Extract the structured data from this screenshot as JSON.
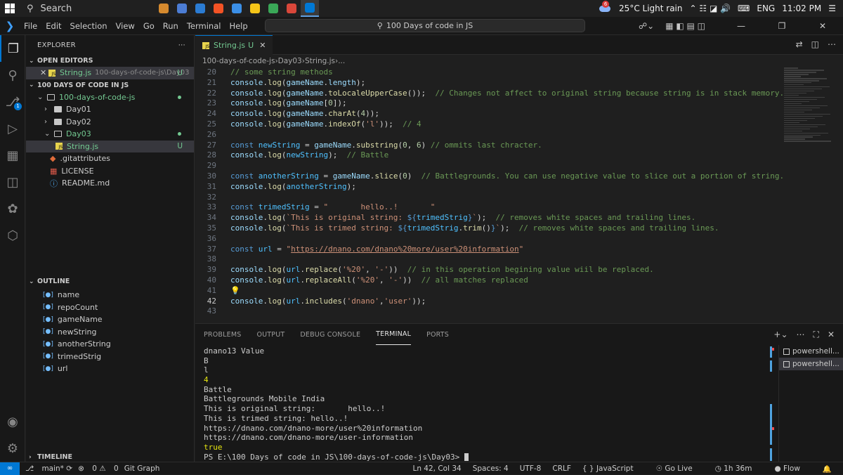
{
  "taskbar": {
    "search_placeholder": "Search",
    "weather_badge": "6",
    "weather": "25°C  Light rain",
    "lang": "ENG",
    "time": "11:02 PM",
    "apps": [
      "#d68a2e",
      "#4c7dd4",
      "#2b7cd3",
      "#f35325",
      "#3b8fe6",
      "#f5c518",
      "#3aa757",
      "#d9473a",
      "#0078d4"
    ]
  },
  "titlebar": {
    "menu": [
      "File",
      "Edit",
      "Selection",
      "View",
      "Go",
      "Run",
      "Terminal",
      "Help"
    ],
    "command_center": "100 Days of code in JS"
  },
  "sidebar": {
    "title": "EXPLORER",
    "open_editors_label": "OPEN EDITORS",
    "open_editor_file": "String.js",
    "open_editor_path": "100-days-of-code-js\\Day03",
    "open_editor_badge": "U",
    "project_label": "100 DAYS OF CODE IN JS",
    "root_folder": "100-days-of-code-js",
    "day01": "Day01",
    "day02": "Day02",
    "day03": "Day03",
    "file_string": "String.js",
    "file_badge": "U",
    "file_gitattributes": ".gitattributes",
    "file_license": "LICENSE",
    "file_readme": "README.md",
    "outline_label": "OUTLINE",
    "outline": [
      "name",
      "repoCount",
      "gameName",
      "newString",
      "anotherString",
      "trimedStrig",
      "url"
    ],
    "timeline_label": "TIMELINE"
  },
  "editor": {
    "tab_label": "String.js",
    "tab_badge": "U",
    "breadcrumb": [
      "100-days-of-code-js",
      "Day03",
      "String.js",
      "..."
    ],
    "lines": [
      {
        "n": "20",
        "html": "<span class=\"c\">// some string methods</span>"
      },
      {
        "n": "21",
        "html": "<span class=\"v\">console</span>.<span class=\"f\">log</span>(<span class=\"v\">gameName</span>.<span class=\"v\">length</span>);"
      },
      {
        "n": "22",
        "html": "<span class=\"v\">console</span>.<span class=\"f\">log</span>(<span class=\"v\">gameName</span>.<span class=\"f\">toLocaleUpperCase</span>());  <span class=\"c\">// Changes not affect to original string because string is in stack memory.</span>"
      },
      {
        "n": "23",
        "html": "<span class=\"v\">console</span>.<span class=\"f\">log</span>(<span class=\"v\">gameName</span>[<span class=\"n\">0</span>]);"
      },
      {
        "n": "24",
        "html": "<span class=\"v\">console</span>.<span class=\"f\">log</span>(<span class=\"v\">gameName</span>.<span class=\"f\">charAt</span>(<span class=\"n\">4</span>));"
      },
      {
        "n": "25",
        "html": "<span class=\"v\">console</span>.<span class=\"f\">log</span>(<span class=\"v\">gameName</span>.<span class=\"f\">indexOf</span>(<span class=\"s\">'l'</span>));  <span class=\"c\">// 4</span>"
      },
      {
        "n": "26",
        "html": ""
      },
      {
        "n": "27",
        "html": "<span class=\"k\">const</span> <span class=\"cst\">newString</span> = <span class=\"v\">gameName</span>.<span class=\"f\">substring</span>(<span class=\"n\">0</span>, <span class=\"n\">6</span>) <span class=\"c\">// ommits last chracter.</span>"
      },
      {
        "n": "28",
        "html": "<span class=\"v\">console</span>.<span class=\"f\">log</span>(<span class=\"cst\">newString</span>);  <span class=\"c\">// Battle</span>"
      },
      {
        "n": "29",
        "html": ""
      },
      {
        "n": "30",
        "html": "<span class=\"k\">const</span> <span class=\"cst\">anotherString</span> = <span class=\"v\">gameName</span>.<span class=\"f\">slice</span>(<span class=\"n\">0</span>)  <span class=\"c\">// Battlegrounds. You can use negative value to slice out a portion of string.</span>"
      },
      {
        "n": "31",
        "html": "<span class=\"v\">console</span>.<span class=\"f\">log</span>(<span class=\"cst\">anotherString</span>);"
      },
      {
        "n": "32",
        "html": ""
      },
      {
        "n": "33",
        "html": "<span class=\"k\">const</span> <span class=\"cst\">trimedStrig</span> = <span class=\"s\">\"       hello..!       \"</span>"
      },
      {
        "n": "34",
        "html": "<span class=\"v\">console</span>.<span class=\"f\">log</span>(<span class=\"s\">`This is original string: </span><span class=\"k\">${</span><span class=\"cst\">trimedStrig</span><span class=\"k\">}</span><span class=\"s\">`</span>);  <span class=\"c\">// removes white spaces and trailing lines.</span>"
      },
      {
        "n": "35",
        "html": "<span class=\"v\">console</span>.<span class=\"f\">log</span>(<span class=\"s\">`This is trimed string: </span><span class=\"k\">${</span><span class=\"cst\">trimedStrig</span>.<span class=\"f\">trim</span>()<span class=\"k\">}</span><span class=\"s\">`</span>);  <span class=\"c\">// removes white spaces and trailing lines.</span>"
      },
      {
        "n": "36",
        "html": ""
      },
      {
        "n": "37",
        "html": "<span class=\"k\">const</span> <span class=\"cst\">url</span> = <span class=\"s\">\"<span class=\"ul\">https://dnano.com/dnano%20more/user%20information</span>\"</span>"
      },
      {
        "n": "38",
        "html": ""
      },
      {
        "n": "39",
        "html": "<span class=\"v\">console</span>.<span class=\"f\">log</span>(<span class=\"cst\">url</span>.<span class=\"f\">replace</span>(<span class=\"s\">'%20'</span>, <span class=\"s\">'-'</span>))  <span class=\"c\">// in this operation begining value wiil be replaced.</span>"
      },
      {
        "n": "40",
        "html": "<span class=\"v\">console</span>.<span class=\"f\">log</span>(<span class=\"cst\">url</span>.<span class=\"f\">replaceAll</span>(<span class=\"s\">'%20'</span>, <span class=\"s\">'-'</span>))  <span class=\"c\">// all matches replaced</span>"
      },
      {
        "n": "41",
        "html": "<span class=\"bulb\">&#128161;</span>"
      },
      {
        "n": "42",
        "html": "<span class=\"v\">console</span>.<span class=\"f\">log</span>(<span class=\"cst\">url</span>.<span class=\"f\">includes</span>(<span class=\"s\">'dnano'</span>,<span class=\"s\">'user'</span>));",
        "current": true
      },
      {
        "n": "43",
        "html": ""
      }
    ]
  },
  "panel": {
    "tabs": [
      "PROBLEMS",
      "OUTPUT",
      "DEBUG CONSOLE",
      "TERMINAL",
      "PORTS"
    ],
    "active_tab": "TERMINAL",
    "output": [
      {
        "t": "dnano13 Value",
        "yellow": false
      },
      {
        "t": "B",
        "yellow": false
      },
      {
        "t": "l",
        "yellow": false
      },
      {
        "t": "4",
        "yellow": true
      },
      {
        "t": "Battle",
        "yellow": false
      },
      {
        "t": "Battlegrounds Mobile India",
        "yellow": false
      },
      {
        "t": "This is original string:       hello..!",
        "yellow": false
      },
      {
        "t": "This is trimed string: hello..!",
        "yellow": false
      },
      {
        "t": "https://dnano.com/dnano-more/user%20information",
        "yellow": false
      },
      {
        "t": "https://dnano.com/dnano-more/user-information",
        "yellow": false
      },
      {
        "t": "true",
        "yellow": true
      }
    ],
    "prompt": "PS E:\\100 Days of code in JS\\100-days-of-code-js\\Day03> ",
    "terminals": [
      "powershell...",
      "powershell..."
    ]
  },
  "status": {
    "branch": "main*",
    "errors": "0",
    "warnings": "0",
    "git_graph": "Git Graph",
    "position": "Ln 42, Col 34",
    "spaces": "Spaces: 4",
    "encoding": "UTF-8",
    "eol": "CRLF",
    "language": "JavaScript",
    "golive": "Go Live",
    "time_tracked": "1h 36m",
    "flow": "Flow"
  }
}
